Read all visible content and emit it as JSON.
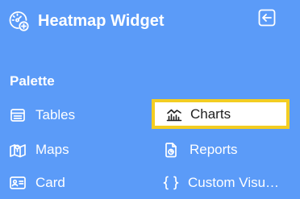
{
  "header": {
    "title": "Heatmap Widget",
    "logo_icon": "dashboard-plus-icon",
    "collapse_icon": "arrow-left-box-icon"
  },
  "palette": {
    "title": "Palette",
    "items": [
      {
        "label": "Tables",
        "icon": "table-icon",
        "selected": false
      },
      {
        "label": "Charts",
        "icon": "line-chart-icon",
        "selected": true
      },
      {
        "label": "Maps",
        "icon": "map-icon",
        "selected": false
      },
      {
        "label": "Reports",
        "icon": "report-document-icon",
        "selected": false
      },
      {
        "label": "Card",
        "icon": "id-card-icon",
        "selected": false
      },
      {
        "label": "Custom Visu…",
        "icon": "curly-braces-icon",
        "selected": false
      }
    ]
  },
  "colors": {
    "background": "#5b9bf8",
    "text": "#ffffff",
    "selected_background": "#ffffff",
    "selected_border": "#f3cd22",
    "selected_text": "#1f1f1f"
  }
}
